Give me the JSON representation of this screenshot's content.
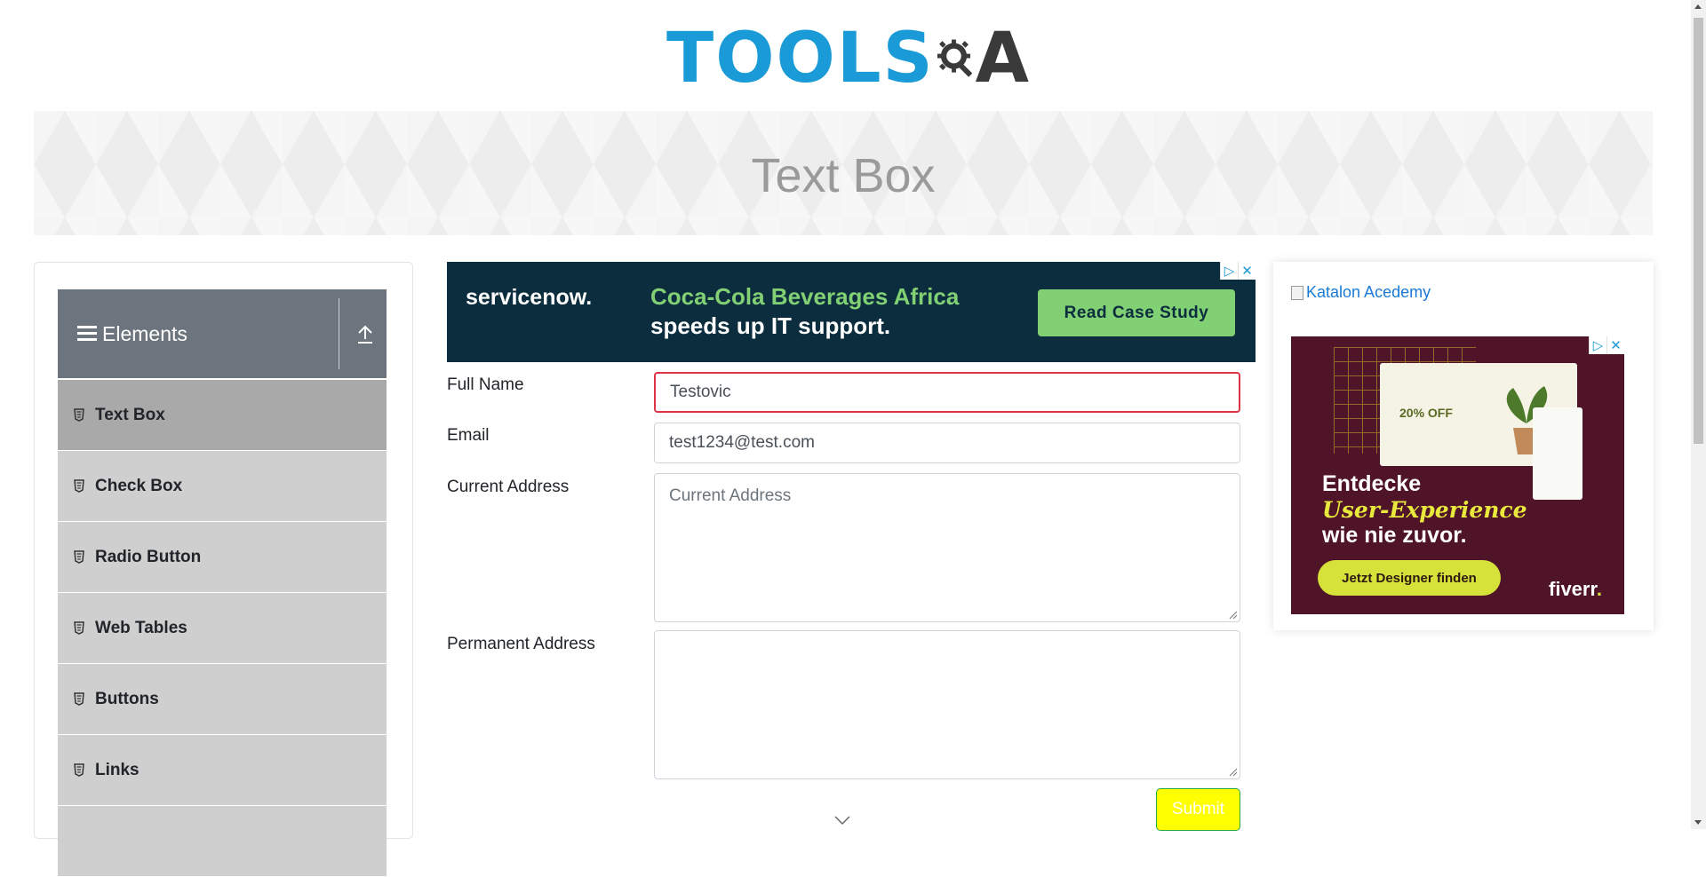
{
  "header": {
    "logo_tools": "TOOLS",
    "logo_qa": "A"
  },
  "banner": {
    "title": "Text Box"
  },
  "sidebar": {
    "group_title": "Elements",
    "items": [
      {
        "label": "Text Box",
        "active": true
      },
      {
        "label": "Check Box",
        "active": false
      },
      {
        "label": "Radio Button",
        "active": false
      },
      {
        "label": "Web Tables",
        "active": false
      },
      {
        "label": "Buttons",
        "active": false
      },
      {
        "label": "Links",
        "active": false
      }
    ]
  },
  "ad_top": {
    "brand": "servicenow.",
    "headline1": "Coca-Cola Beverages Africa",
    "headline2": "speeds up IT support.",
    "cta": "Read Case Study"
  },
  "form": {
    "full_name_label": "Full Name",
    "full_name_value": "Testovic",
    "email_label": "Email",
    "email_value": "test1234@test.com",
    "current_address_label": "Current Address",
    "current_address_placeholder": "Current Address",
    "permanent_address_label": "Permanent Address",
    "submit_label": "Submit"
  },
  "right_ads": {
    "katalon_alt": "Katalon Acedemy",
    "fiverr_offer": "20% OFF",
    "fiverr_line1": "Entdecke",
    "fiverr_line2": "User-Experience",
    "fiverr_line3": "wie nie zuvor.",
    "fiverr_cta": "Jetzt Designer finden",
    "fiverr_logo": "fiverr"
  },
  "colors": {
    "brand_blue": "#1a9ad6",
    "nav_header": "#6c757d",
    "nav_active": "#a9a9a9",
    "nav_item": "#cfcfcf",
    "error_border": "#dc3545",
    "submit_bg": "#ffff00"
  }
}
